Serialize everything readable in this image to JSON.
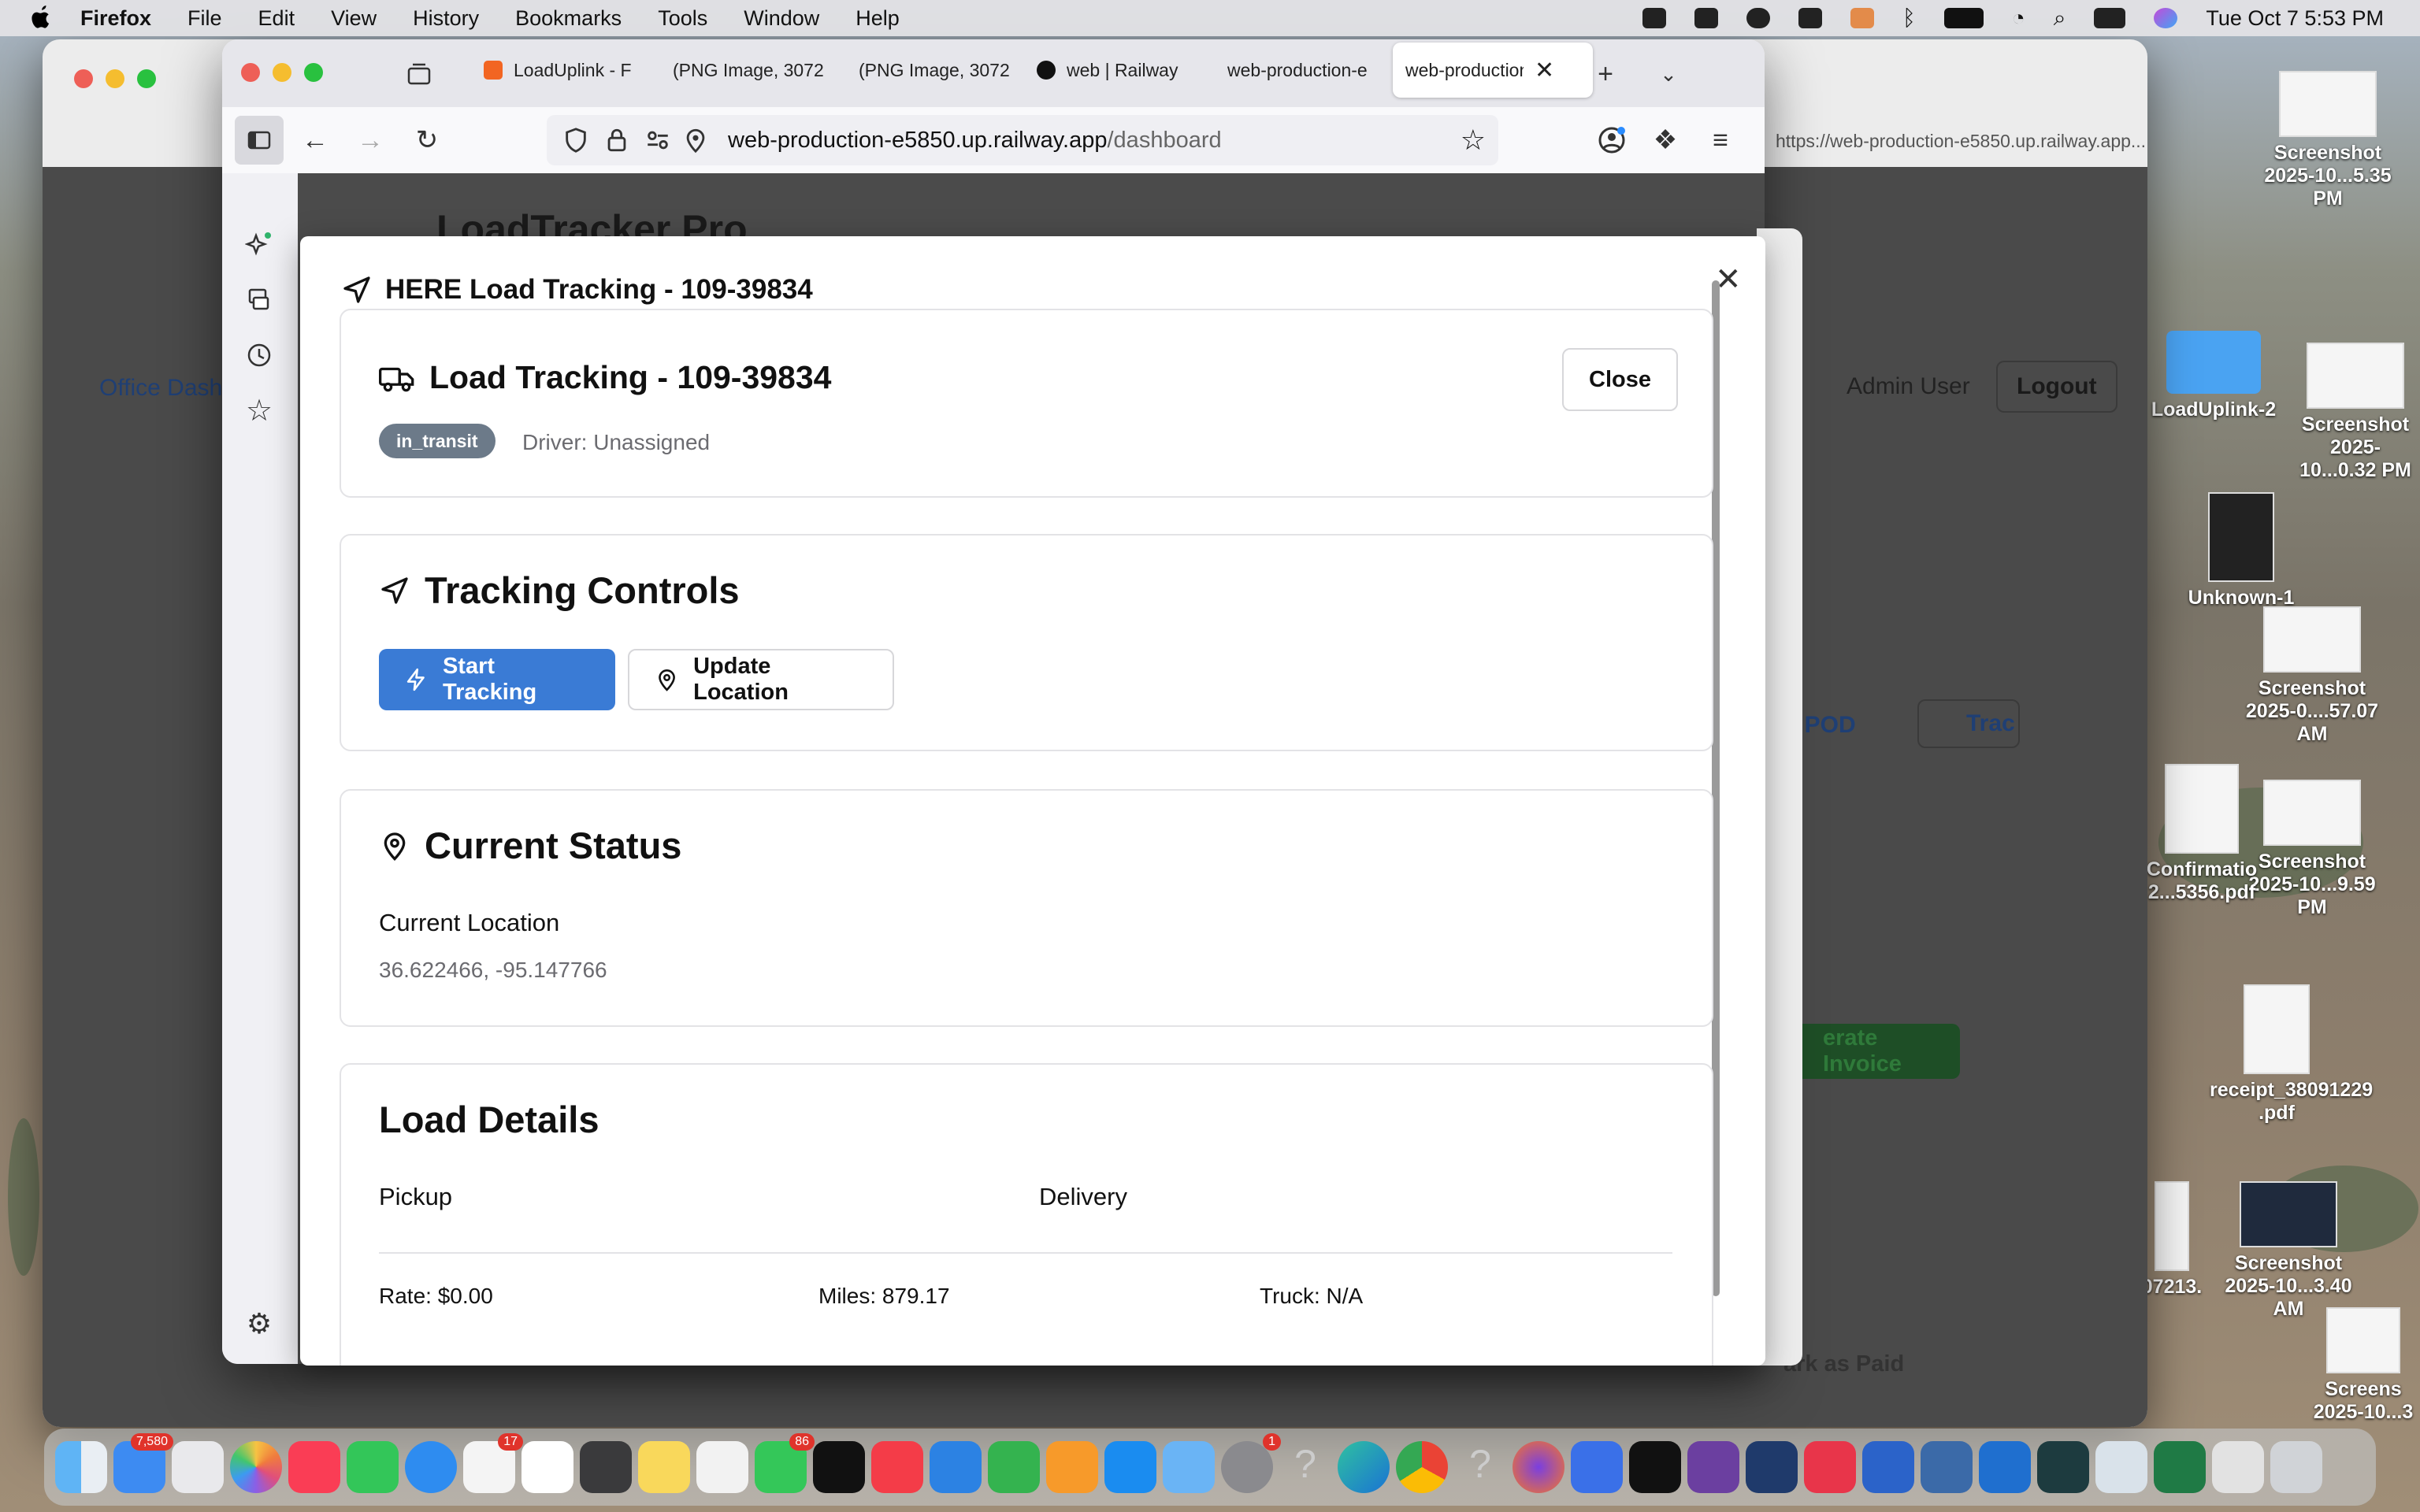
{
  "menubar": {
    "app": "Firefox",
    "items": [
      "File",
      "Edit",
      "View",
      "History",
      "Bookmarks",
      "Tools",
      "Window",
      "Help"
    ],
    "datetime": "Tue Oct 7  5:53 PM"
  },
  "browser": {
    "tabs": [
      {
        "label": "LoadUplink - F",
        "favicon_color": "#f26522"
      },
      {
        "label": "(PNG Image, 3072",
        "favicon_color": "#bbbbbb"
      },
      {
        "label": "(PNG Image, 3072",
        "favicon_color": "#bbbbbb"
      },
      {
        "label": "web | Railway",
        "favicon_color": "#111111"
      },
      {
        "label": "web-production-e",
        "favicon_color": "#bbbbbb"
      },
      {
        "label": "web-production",
        "favicon_color": "#bbbbbb"
      }
    ],
    "url_host": "web-production-e5850.up.railway.app",
    "url_path": "/dashboard",
    "back_window_url": "https://web-production-e5850.up.railway.app..."
  },
  "app": {
    "title": "LoadTracker Pro",
    "admin_user": "Admin User",
    "logout": "Logout",
    "office_dash": "Office Dash",
    "pod_btn": "d POD",
    "track_btn": "Trac",
    "invoice_btn": "erate Invoice",
    "paid_btn": "ark as Paid"
  },
  "modal": {
    "header": "HERE Load Tracking - 109-39834",
    "load_card": {
      "title": "Load Tracking - 109-39834",
      "status": "in_transit",
      "driver": "Driver: Unassigned",
      "close": "Close"
    },
    "controls": {
      "title": "Tracking Controls",
      "start": "Start Tracking",
      "update": "Update Location"
    },
    "status_card": {
      "title": "Current Status",
      "location_label": "Current Location",
      "coords": "36.622466, -95.147766"
    },
    "details": {
      "title": "Load Details",
      "pickup": "Pickup",
      "delivery": "Delivery",
      "rate": "Rate: $0.00",
      "miles": "Miles: 879.17",
      "truck": "Truck: N/A"
    }
  },
  "desktop_icons": [
    {
      "label": "Screenshot 2025-10...5.35 PM"
    },
    {
      "label": "Screenshot 2025-10...0.32 PM"
    },
    {
      "label": "LoadUplink-2"
    },
    {
      "label": "Unknown-1"
    },
    {
      "label": "Screenshot 2025-0....57.07 AM"
    },
    {
      "label": "Screenshot 2025-10...9.59 PM"
    },
    {
      "label": "Confirmatio 2...5356.pdf"
    },
    {
      "label": "receipt_38091229 .pdf"
    },
    {
      "label": "Screenshot 2025-10...3.40 AM"
    },
    {
      "label": "07213."
    },
    {
      "label": "Screens 2025-10...3"
    }
  ],
  "dock_badges": {
    "mail": "7,580",
    "reminders": "17",
    "messages": "86",
    "settings": "1"
  }
}
